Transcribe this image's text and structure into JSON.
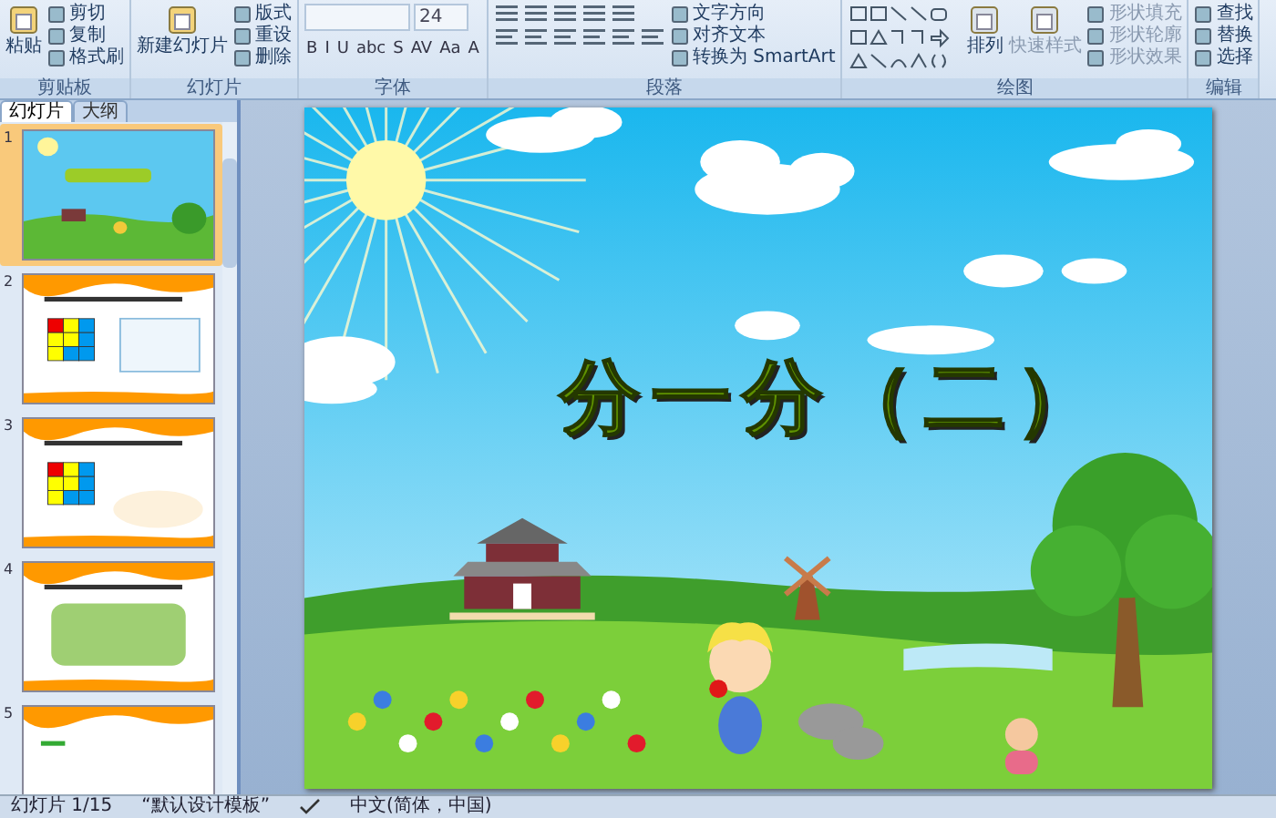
{
  "ribbon": {
    "groups": [
      {
        "kind": "commands",
        "label": "剪贴板",
        "large": [
          "粘贴"
        ],
        "small": [
          "剪切",
          "复制",
          "格式刷"
        ]
      },
      {
        "kind": "commands",
        "label": "幻灯片",
        "large": [
          "新建幻灯片"
        ],
        "small": [
          "版式",
          "重设",
          "删除"
        ]
      },
      {
        "kind": "font",
        "label": "字体",
        "size": "24",
        "format_buttons": [
          "B",
          "I",
          "U",
          "abc",
          "S",
          "AV",
          "Aa",
          "A"
        ]
      },
      {
        "kind": "paragraph",
        "label": "段落",
        "small": [
          "文字方向",
          "对齐文本",
          "转换为 SmartArt"
        ]
      },
      {
        "kind": "drawing",
        "label": "绘图",
        "large": [
          "排列",
          "快速样式"
        ],
        "small": [
          "形状填充",
          "形状轮廓",
          "形状效果"
        ]
      },
      {
        "kind": "commands",
        "label": "编辑",
        "small": [
          "查找",
          "替换",
          "选择"
        ]
      }
    ]
  },
  "panel": {
    "tabs": [
      {
        "label": "幻灯片",
        "selected": true
      },
      {
        "label": "大纲",
        "selected": false
      }
    ],
    "slides": [
      {
        "number": "1",
        "kind": "title",
        "selected": true
      },
      {
        "number": "2",
        "kind": "grid-list",
        "selected": false
      },
      {
        "number": "3",
        "kind": "grid-bubble",
        "selected": false
      },
      {
        "number": "4",
        "kind": "picture",
        "selected": false
      },
      {
        "number": "5",
        "kind": "blank",
        "selected": false
      }
    ]
  },
  "slide": {
    "title": "分一分（二）"
  },
  "status_bar": {
    "slide_counter": "幻灯片 1/15",
    "theme": "“默认设计模板”",
    "language": "中文(简体，中国)"
  }
}
